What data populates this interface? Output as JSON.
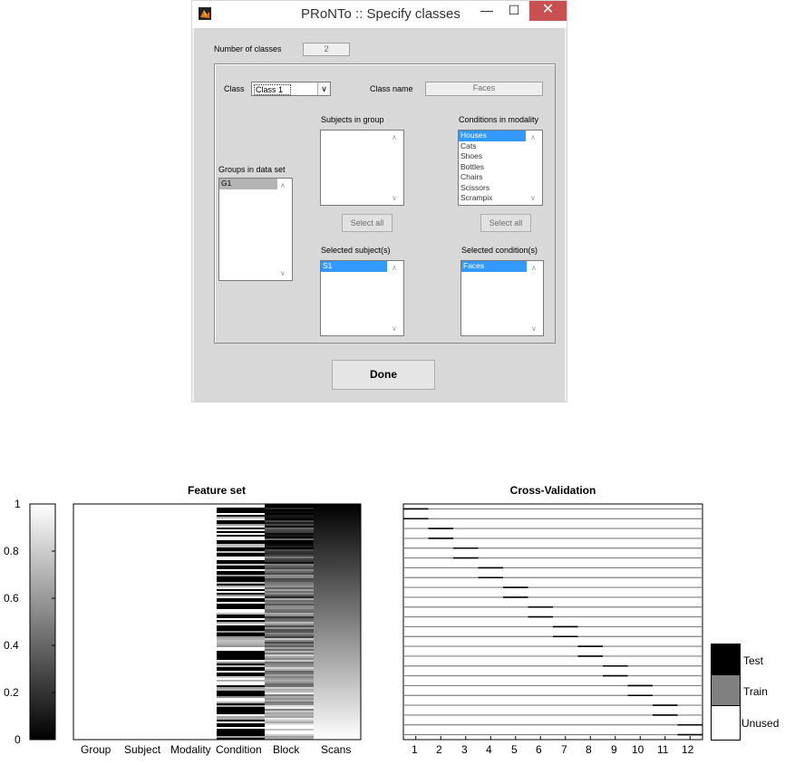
{
  "dialog": {
    "title": "PRoNTo :: Specify classes",
    "minimize_glyph": "—",
    "maximize_glyph": "☐",
    "close_glyph": "✕",
    "number_of_classes_label": "Number of classes",
    "number_of_classes_value": "2",
    "class_label": "Class",
    "class_selected": "Class 1",
    "class_name_label": "Class name",
    "class_name_value": "Faces",
    "groups_label": "Groups in data set",
    "groups": [
      "G1"
    ],
    "subjects_label": "Subjects in group",
    "subjects": [],
    "conditions_label": "Conditions in modality",
    "conditions": [
      "Houses",
      "Cats",
      "Shoes",
      "Bottles",
      "Chairs",
      "Scissors",
      "Scrampix"
    ],
    "select_all_subjects": "Select all",
    "select_all_conditions": "Select all",
    "selected_subjects_label": "Selected subject(s)",
    "selected_subjects": [
      "S1"
    ],
    "selected_conditions_label": "Selected condition(s)",
    "selected_conditions": [
      "Faces"
    ],
    "done_label": "Done",
    "colors": {
      "selection": "#3399ff",
      "close": "#c75050",
      "panel": "#d8d8d8"
    }
  },
  "feature_set": {
    "title": "Feature set",
    "colorbar_ticks": [
      "1",
      "0.8",
      "0.6",
      "0.4",
      "0.2",
      "0"
    ],
    "columns": [
      "Group",
      "Subject",
      "Modality",
      "Condition",
      "Block",
      "Scans"
    ]
  },
  "cross_validation": {
    "title": "Cross-Validation",
    "x_ticks": [
      "1",
      "2",
      "3",
      "4",
      "5",
      "6",
      "7",
      "8",
      "9",
      "10",
      "11",
      "12"
    ],
    "legend": [
      {
        "label": "Test",
        "color": "#000000"
      },
      {
        "label": "Train",
        "color": "#808080"
      },
      {
        "label": "Unused",
        "color": "#ffffff"
      }
    ]
  }
}
